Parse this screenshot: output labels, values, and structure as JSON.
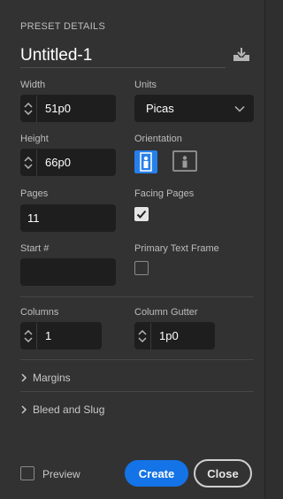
{
  "header": {
    "section_title": "PRESET DETAILS",
    "preset_name": "Untitled-1",
    "save_icon": "save-preset-icon"
  },
  "width": {
    "label": "Width",
    "value": "51p0"
  },
  "units": {
    "label": "Units",
    "value": "Picas"
  },
  "height": {
    "label": "Height",
    "value": "66p0"
  },
  "orientation": {
    "label": "Orientation",
    "selected": "portrait"
  },
  "pages": {
    "label": "Pages",
    "value": "11"
  },
  "facing_pages": {
    "label": "Facing Pages",
    "checked": true
  },
  "start": {
    "label": "Start #",
    "value": ""
  },
  "primary_text_frame": {
    "label": "Primary Text Frame",
    "checked": false
  },
  "columns": {
    "label": "Columns",
    "value": "1"
  },
  "column_gutter": {
    "label": "Column Gutter",
    "value": "1p0"
  },
  "sections": {
    "margins": "Margins",
    "bleed_slug": "Bleed and Slug"
  },
  "footer": {
    "preview_label": "Preview",
    "preview_checked": false,
    "create_label": "Create",
    "close_label": "Close"
  },
  "colors": {
    "panel_bg": "#323232",
    "field_bg": "#1e1e1e",
    "accent": "#2680eb",
    "primary_button": "#1473e6"
  }
}
